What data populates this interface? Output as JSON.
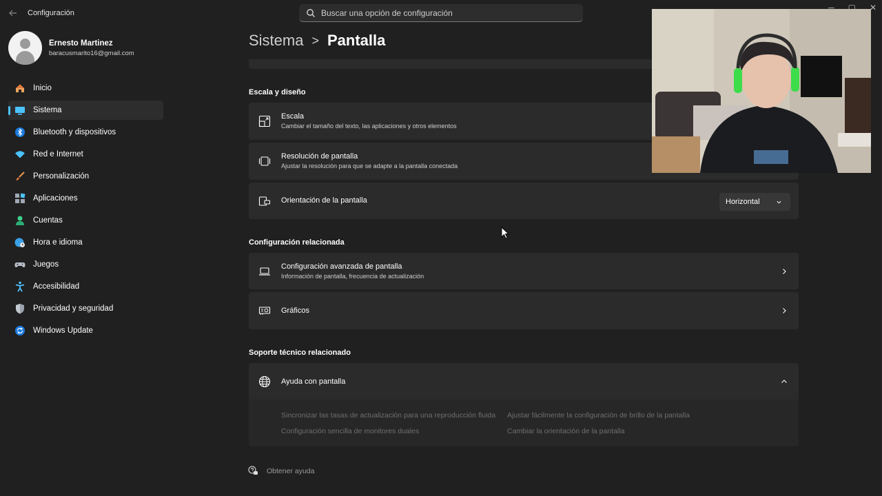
{
  "titlebar": {
    "app_title": "Configuración",
    "search_placeholder": "Buscar una opción de configuración"
  },
  "profile": {
    "name": "Ernesto Martinez",
    "email": "baracusmarito16@gmail.com"
  },
  "sidebar": {
    "items": [
      {
        "label": "Inicio",
        "icon": "home-icon"
      },
      {
        "label": "Sistema",
        "icon": "system-icon",
        "active": true
      },
      {
        "label": "Bluetooth y dispositivos",
        "icon": "bluetooth-icon"
      },
      {
        "label": "Red e Internet",
        "icon": "wifi-icon"
      },
      {
        "label": "Personalización",
        "icon": "brush-icon"
      },
      {
        "label": "Aplicaciones",
        "icon": "apps-icon"
      },
      {
        "label": "Cuentas",
        "icon": "account-icon"
      },
      {
        "label": "Hora e idioma",
        "icon": "globe-clock-icon"
      },
      {
        "label": "Juegos",
        "icon": "gamepad-icon"
      },
      {
        "label": "Accesibilidad",
        "icon": "accessibility-icon"
      },
      {
        "label": "Privacidad y seguridad",
        "icon": "shield-icon"
      },
      {
        "label": "Windows Update",
        "icon": "update-icon"
      }
    ]
  },
  "breadcrumb": {
    "parent": "Sistema",
    "separator": ">",
    "current": "Pantalla"
  },
  "scale_section": {
    "title": "Escala y diseño",
    "scale": {
      "title": "Escala",
      "subtitle": "Cambiar el tamaño del texto, las aplicaciones y otros elementos"
    },
    "resolution": {
      "title": "Resolución de pantalla",
      "subtitle": "Ajustar la resolución para que se adapte a la pantalla conectada"
    },
    "orientation": {
      "title": "Orientación de la pantalla",
      "value": "Horizontal"
    }
  },
  "related_section": {
    "title": "Configuración relacionada",
    "advanced": {
      "title": "Configuración avanzada de pantalla",
      "subtitle": "Información de pantalla, frecuencia de actualización"
    },
    "graphics": {
      "title": "Gráficos"
    }
  },
  "support_section": {
    "title": "Soporte técnico relacionado",
    "help": {
      "title": "Ayuda con pantalla"
    },
    "links": [
      "Sincronizar las tasas de actualización para una reproducción fluida",
      "Ajustar fácilmente la configuración de brillo de la pantalla",
      "Configuración sencilla de monitores duales",
      "Cambiar la orientación de la pantalla"
    ]
  },
  "footer": {
    "get_help": "Obtener ayuda"
  },
  "colors": {
    "background": "#202020",
    "card": "#2b2b2b",
    "accent": "#4cc2ff"
  }
}
